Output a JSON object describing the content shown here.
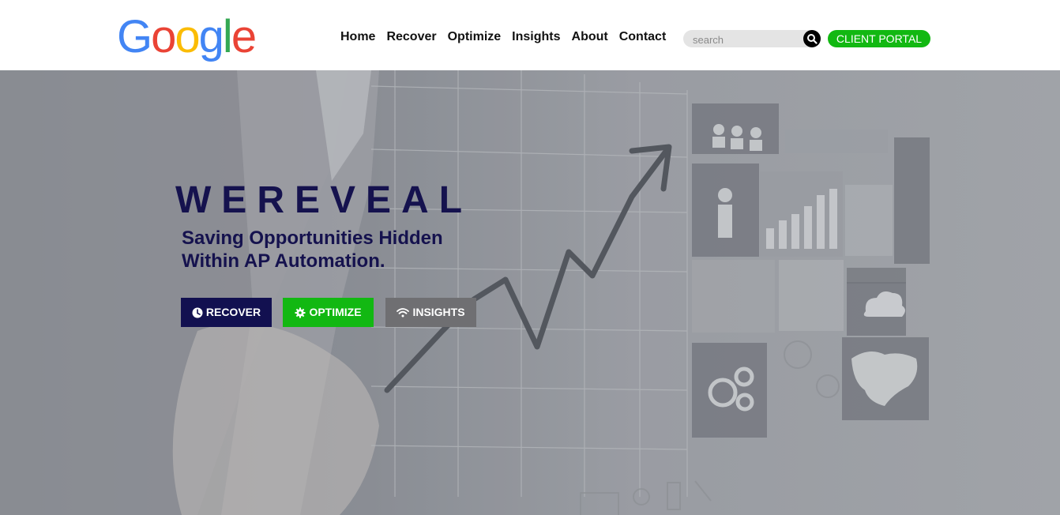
{
  "header": {
    "logo_letters": [
      {
        "char": "G",
        "color": "#4285F4"
      },
      {
        "char": "o",
        "color": "#EA4335"
      },
      {
        "char": "o",
        "color": "#FBBC05"
      },
      {
        "char": "g",
        "color": "#4285F4"
      },
      {
        "char": "l",
        "color": "#34A853"
      },
      {
        "char": "e",
        "color": "#EA4335"
      }
    ],
    "nav": [
      "Home",
      "Recover",
      "Optimize",
      "Insights",
      "About",
      "Contact"
    ],
    "search": {
      "placeholder": "search",
      "icon": "search-icon"
    },
    "portal_button": "CLIENT PORTAL"
  },
  "hero": {
    "title": "WEREVEAL",
    "subtitle": "Saving Opportunities Hidden Within AP Automation.",
    "buttons": [
      {
        "label": "RECOVER",
        "icon": "clock-icon",
        "color": "#121050"
      },
      {
        "label": "OPTIMIZE",
        "icon": "gear-icon",
        "color": "#12b812"
      },
      {
        "label": "INSIGHTS",
        "icon": "wifi-icon",
        "color": "#6f6f72"
      }
    ]
  },
  "colors": {
    "accent_green": "#12b812",
    "navy": "#15124e"
  }
}
